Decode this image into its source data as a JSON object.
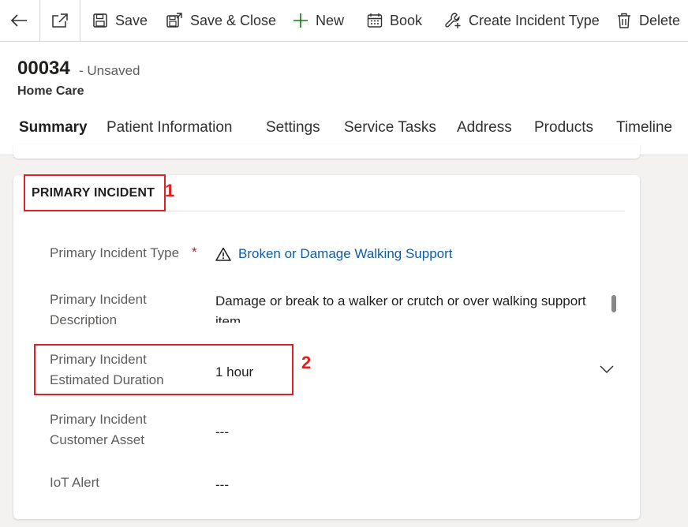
{
  "commandbar": {
    "save": "Save",
    "save_close": "Save & Close",
    "new": "New",
    "book": "Book",
    "create_incident_type": "Create Incident Type",
    "delete": "Delete"
  },
  "record": {
    "id": "00034",
    "status": "- Unsaved",
    "entity": "Home Care"
  },
  "tabs": [
    {
      "label": "Summary",
      "active": true
    },
    {
      "label": "Patient Information"
    },
    {
      "label": "Settings"
    },
    {
      "label": "Service Tasks"
    },
    {
      "label": "Address"
    },
    {
      "label": "Products"
    },
    {
      "label": "Timeline"
    }
  ],
  "section": {
    "title": "PRIMARY INCIDENT",
    "fields": {
      "incident_type": {
        "label": "Primary Incident Type",
        "required_marker": "*",
        "value": "Broken or Damage Walking Support",
        "icon": "warning-icon"
      },
      "description": {
        "label_line1": "Primary Incident",
        "label_line2": "Description",
        "value": "Damage or break to a walker or crutch or over walking support item"
      },
      "estimated_duration": {
        "label_line1": "Primary Incident",
        "label_line2": "Estimated Duration",
        "value": "1 hour"
      },
      "customer_asset": {
        "label_line1": "Primary Incident",
        "label_line2": "Customer Asset",
        "value": "---"
      },
      "iot_alert": {
        "label": "IoT Alert",
        "value": "---"
      }
    }
  },
  "annotations": {
    "marker1": "1",
    "marker2": "2"
  },
  "colors": {
    "accent": "#0f6cbd",
    "link": "#115ea3",
    "annotation": "#e02020",
    "new_icon": "#107c10"
  }
}
